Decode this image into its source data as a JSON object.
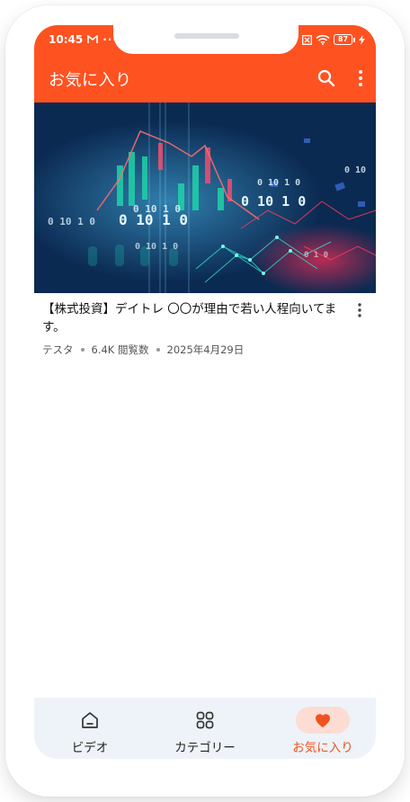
{
  "status_bar": {
    "time": "10:45",
    "left_indicators": [
      "gmail-icon",
      "more-dots"
    ],
    "right_indicators": [
      "close-box-icon",
      "wifi-icon",
      "battery-icon",
      "charging-bolt-icon"
    ],
    "battery_text": "87"
  },
  "app_bar": {
    "title": "お気に入り",
    "actions": [
      "search-icon",
      "more-vert-icon"
    ],
    "background": "#fe5221"
  },
  "video": {
    "title": "【株式投資】デイトレ 〇〇が理由で若い人程向いてます。",
    "channel": "テスタ",
    "views": "6.4K 閲覧数",
    "date": "2025年4月29日",
    "thumbnail_text": [
      "0 10 1 0",
      "0 10 1 0",
      "0 10 1 0",
      "0 10 1 0",
      "0 10 1 0",
      "0 10 1 0",
      "0 10",
      "0 1 0"
    ]
  },
  "bottom_nav": {
    "items": [
      {
        "label": "ビデオ",
        "icon": "home-icon",
        "active": false
      },
      {
        "label": "カテゴリー",
        "icon": "grid-icon",
        "active": false
      },
      {
        "label": "お気に入り",
        "icon": "heart-icon",
        "active": true
      }
    ],
    "active_color": "#f0521f"
  }
}
